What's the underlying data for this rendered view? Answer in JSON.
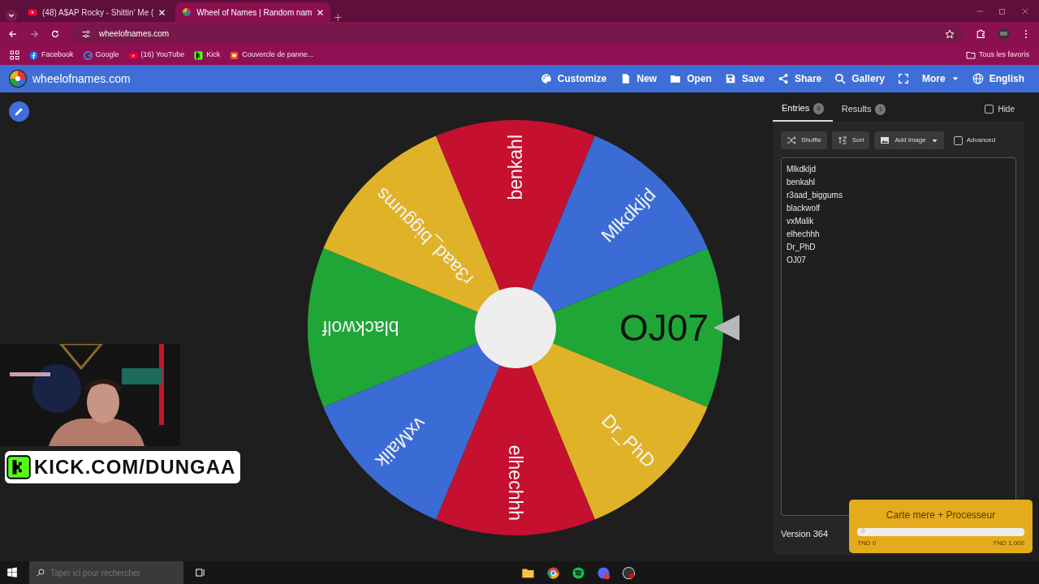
{
  "browser": {
    "tabs": [
      {
        "title": "(48) A$AP Rocky - Shittin' Me (",
        "selected": false
      },
      {
        "title": "Wheel of Names | Random nam",
        "selected": true
      }
    ],
    "address": "wheelofnames.com",
    "bookmarks": [
      {
        "label": "Facebook"
      },
      {
        "label": "Google"
      },
      {
        "label": "(16) YouTube"
      },
      {
        "label": "Kick"
      },
      {
        "label": "Couvercle de panne..."
      }
    ],
    "all_bookmarks": "Tous les favoris"
  },
  "app": {
    "brand": "wheelofnames.com",
    "menu": [
      {
        "label": "Customize",
        "kind": "button"
      },
      {
        "label": "New",
        "kind": "button"
      },
      {
        "label": "Open",
        "kind": "button"
      },
      {
        "label": "Save",
        "kind": "button"
      },
      {
        "label": "Share",
        "kind": "button"
      },
      {
        "label": "Gallery",
        "kind": "button"
      },
      {
        "label": "More",
        "kind": "dropdown"
      },
      {
        "label": "English",
        "kind": "button"
      }
    ]
  },
  "wheel": {
    "segments": [
      {
        "label": "OJ07",
        "color": "#1fa637"
      },
      {
        "label": "Dr_PhD",
        "color": "#e0b228"
      },
      {
        "label": "elhechhh",
        "color": "#c5102f"
      },
      {
        "label": "vxMalik",
        "color": "#3b6cd6"
      },
      {
        "label": "blackwolf",
        "color": "#1fa637"
      },
      {
        "label": "r3aad_biggums",
        "color": "#e0b228"
      },
      {
        "label": "benkahl",
        "color": "#c5102f"
      },
      {
        "label": "Mlkdkljd",
        "color": "#3b6cd6"
      }
    ]
  },
  "panel": {
    "tabs": [
      {
        "label": "Entries",
        "count": "8",
        "selected": true
      },
      {
        "label": "Results",
        "count": "1",
        "selected": false
      }
    ],
    "hide": {
      "label": "Hide",
      "checked": false
    },
    "tools": [
      {
        "label": "Shuffle",
        "kind": "button"
      },
      {
        "label": "Sort",
        "kind": "button"
      },
      {
        "label": "Add image",
        "kind": "dropdown"
      }
    ],
    "advanced": {
      "label": "Advanced",
      "checked": false
    },
    "entries": [
      "Mlkdkljd",
      "benkahl",
      "r3aad_biggums",
      "blackwolf",
      "vxMalik",
      "elhechhh",
      "Dr_PhD",
      "OJ07"
    ],
    "version": "Version 364"
  },
  "stream_overlay": {
    "banner": "KICK.COM/DUNGAA",
    "goal": {
      "title": "Carte mere + Processeur",
      "level": 0,
      "bar_text": "0",
      "min": "TND 0",
      "max": "TND 1,000"
    }
  },
  "taskbar": {
    "search_placeholder": "Taper ici pour rechercher"
  }
}
